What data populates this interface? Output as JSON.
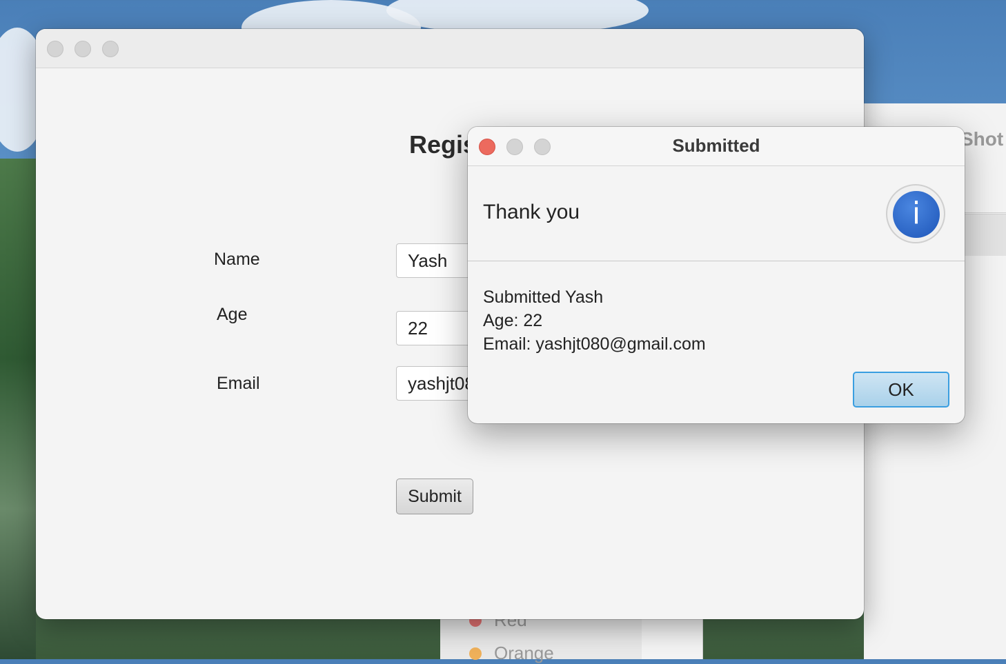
{
  "main_window": {
    "form_title": "Regis",
    "labels": {
      "name": "Name",
      "age": "Age",
      "email": "Email"
    },
    "fields": {
      "name": "Yash",
      "age": "22",
      "email": "yashjt08"
    },
    "submit_label": "Submit"
  },
  "dialog": {
    "title": "Submitted",
    "header_text": "Thank you",
    "icon": "info-icon",
    "icon_glyph": "i",
    "body_lines": [
      "Submitted Yash",
      "Age: 22",
      "Email: yashjt080@gmail.com"
    ],
    "ok_label": "OK"
  },
  "background": {
    "window_title_fragment": "Shot",
    "list_items": [
      {
        "label": "Red",
        "color": "#e57373"
      },
      {
        "label": "Orange",
        "color": "#f0b15a"
      }
    ]
  },
  "colors": {
    "close_red": "#ec6a5e",
    "ok_border": "#3a9ee0",
    "info_blue": "#1d55b8"
  }
}
